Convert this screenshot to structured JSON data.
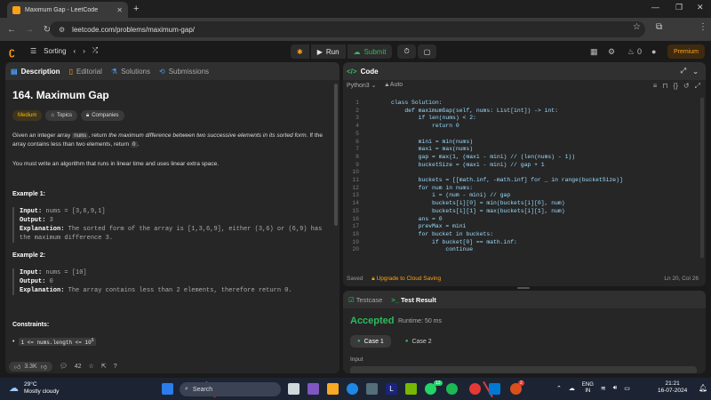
{
  "browser": {
    "tab_title": "Maximum Gap - LeetCode",
    "url": "leetcode.com/problems/maximum-gap/",
    "avatar_letter": "C"
  },
  "lc_nav": {
    "problem_list": "Sorting",
    "run": "Run",
    "submit": "Submit",
    "fire_count": "0",
    "premium": "Premium"
  },
  "left_panel": {
    "tabs": [
      "Description",
      "Editorial",
      "Solutions",
      "Submissions"
    ],
    "title": "164. Maximum Gap",
    "badges": [
      "Medium",
      "Topics",
      "Companies"
    ],
    "desc_p1_a": "Given an integer array ",
    "desc_p1_code": "nums",
    "desc_p1_b": ", return ",
    "desc_p1_em": "the maximum difference between two successive elements in its sorted form",
    "desc_p1_c": ". If the array contains less than two elements, return ",
    "desc_p1_code2": "0",
    "desc_p1_d": ".",
    "desc_p2": "You must write an algorithm that runs in linear time and uses linear extra space.",
    "example1": {
      "heading": "Example 1:",
      "input_label": "Input:",
      "input": "nums = [3,6,9,1]",
      "output_label": "Output:",
      "output": "3",
      "expl_label": "Explanation:",
      "expl": "The sorted form of the array is [1,3,6,9], either (3,6) or (6,9) has the maximum difference 3."
    },
    "example2": {
      "heading": "Example 2:",
      "input_label": "Input:",
      "input": "nums = [10]",
      "output_label": "Output:",
      "output": "0",
      "expl_label": "Explanation:",
      "expl": "The array contains less than 2 elements, therefore return 0."
    },
    "constraints_heading": "Constraints:",
    "constraint1": "1 <= nums.length <= 10",
    "constraint1_sup": "5",
    "likes": "3.3K",
    "comments": "42"
  },
  "code_panel": {
    "title": "Code",
    "language": "Python3",
    "auto": "Auto",
    "saved": "Saved",
    "upgrade": "Upgrade to Cloud Saving",
    "cursor": "Ln 20, Col 26",
    "lines": [
      {
        "n": "1",
        "t": "class Solution:"
      },
      {
        "n": "2",
        "t": "    def maximumGap(self, nums: List[int]) -> int:"
      },
      {
        "n": "3",
        "t": "        if len(nums) < 2:"
      },
      {
        "n": "4",
        "t": "            return 0"
      },
      {
        "n": "5",
        "t": ""
      },
      {
        "n": "6",
        "t": "        mini = min(nums)"
      },
      {
        "n": "7",
        "t": "        maxi = max(nums)"
      },
      {
        "n": "8",
        "t": "        gap = max(1, (maxi - mini) // (len(nums) - 1))"
      },
      {
        "n": "9",
        "t": "        bucketSize = (maxi - mini) // gap + 1"
      },
      {
        "n": "10",
        "t": ""
      },
      {
        "n": "11",
        "t": "        buckets = [[math.inf, -math.inf] for _ in range(bucketSize)]"
      },
      {
        "n": "12",
        "t": "        for num in nums:"
      },
      {
        "n": "13",
        "t": "            i = (num - mini) // gap"
      },
      {
        "n": "14",
        "t": "            buckets[i][0] = min(buckets[i][0], num)"
      },
      {
        "n": "15",
        "t": "            buckets[i][1] = max(buckets[i][1], num)"
      },
      {
        "n": "16",
        "t": "        ans = 0"
      },
      {
        "n": "17",
        "t": "        prevMax = mini"
      },
      {
        "n": "18",
        "t": "        for bucket in buckets:"
      },
      {
        "n": "19",
        "t": "            if bucket[0] == math.inf:"
      },
      {
        "n": "20",
        "t": "                continue"
      }
    ]
  },
  "test_panel": {
    "tabs": [
      "Testcase",
      "Test Result"
    ],
    "status": "Accepted",
    "runtime": "Runtime: 50 ms",
    "cases": [
      "Case 1",
      "Case 2"
    ],
    "input_label": "Input"
  },
  "taskbar": {
    "temp": "29°C",
    "weather": "Mostly cloudy",
    "search": "Search",
    "lang1": "ENG",
    "lang2": "IN",
    "time": "21:21",
    "date": "16-07-2024",
    "badge1": "13",
    "badge2": "2"
  }
}
